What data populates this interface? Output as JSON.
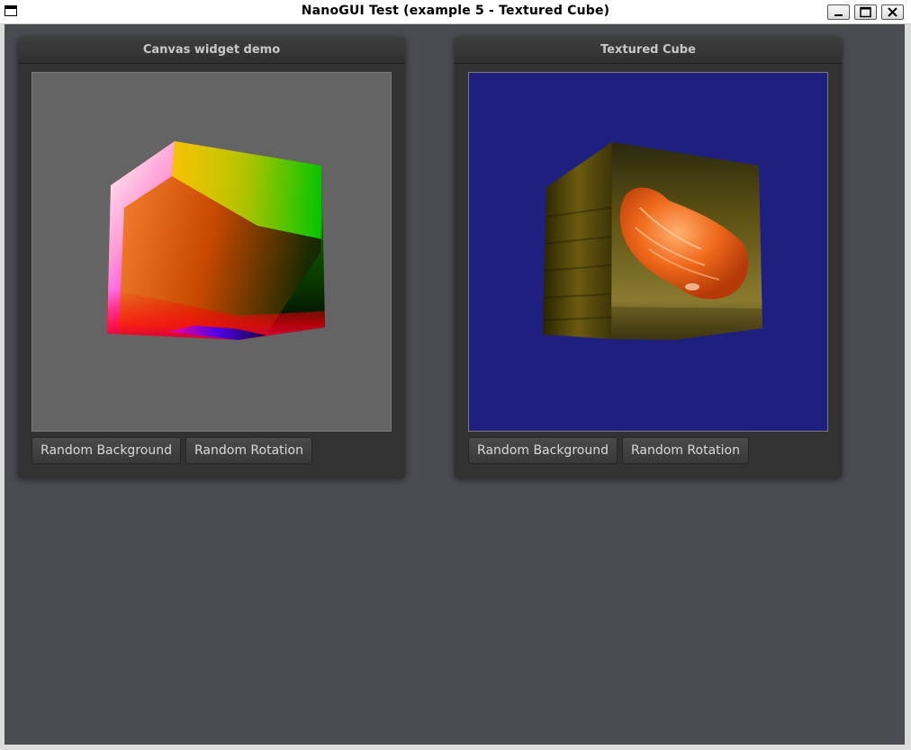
{
  "window": {
    "title": "NanoGUI Test (example 5 - Textured Cube)",
    "controls": [
      "minimize-icon",
      "maximize-icon",
      "close-icon"
    ]
  },
  "panels": [
    {
      "title": "Canvas widget demo",
      "canvas_background": "#646464",
      "buttons": [
        "Random Background",
        "Random Rotation"
      ]
    },
    {
      "title": "Textured Cube",
      "canvas_background": "#1f1f80",
      "buttons": [
        "Random Background",
        "Random Rotation"
      ]
    }
  ],
  "colors": {
    "desktop_background": "#4b4b52",
    "panel_background": "#323232",
    "button_text": "#d8d8d8"
  }
}
